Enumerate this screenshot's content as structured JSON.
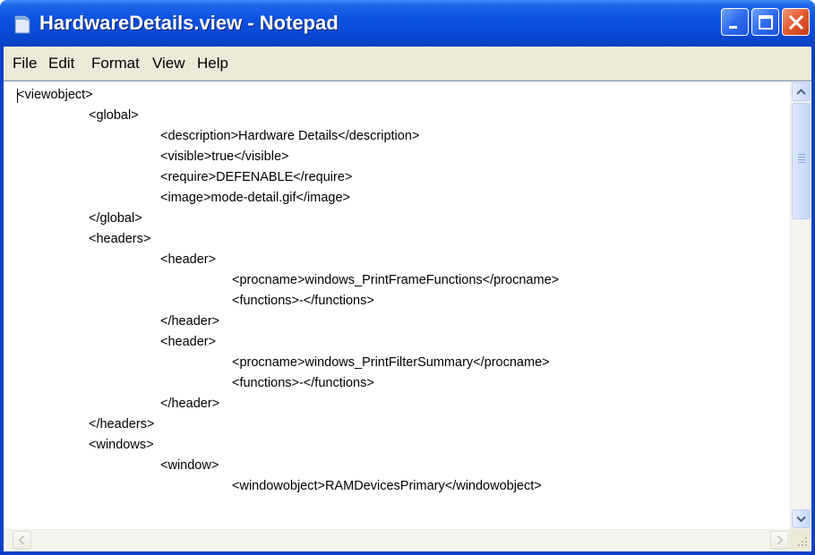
{
  "window": {
    "title": "HardwareDetails.view - Notepad",
    "icon": "notepad-icon",
    "controls": [
      "minimize-icon",
      "maximize-icon",
      "close-icon"
    ]
  },
  "menu": {
    "items": [
      "File",
      "Edit",
      "Format",
      "View",
      "Help"
    ]
  },
  "editor": {
    "lines": [
      "<viewobject>",
      "<global>",
      "<description>Hardware Details</description>",
      "<visible>true</visible>",
      "<require>DEFENABLE</require>",
      "<image>mode-detail.gif</image>",
      "</global>",
      "<headers>",
      "<header>",
      "<procname>windows_PrintFrameFunctions</procname>",
      "<functions>-</functions>",
      "</header>",
      "<header>",
      "<procname>windows_PrintFilterSummary</procname>",
      "<functions>-</functions>",
      "</header>",
      "</headers>",
      "<windows>",
      "<window>",
      "<windowobject>RAMDevicesPrimary</windowobject>"
    ]
  },
  "colors": {
    "titlebar": "#0a4ad6",
    "menubar": "#ece9d8",
    "close_button": "#e15a2f",
    "scrollbar": "#c6d6f7"
  }
}
